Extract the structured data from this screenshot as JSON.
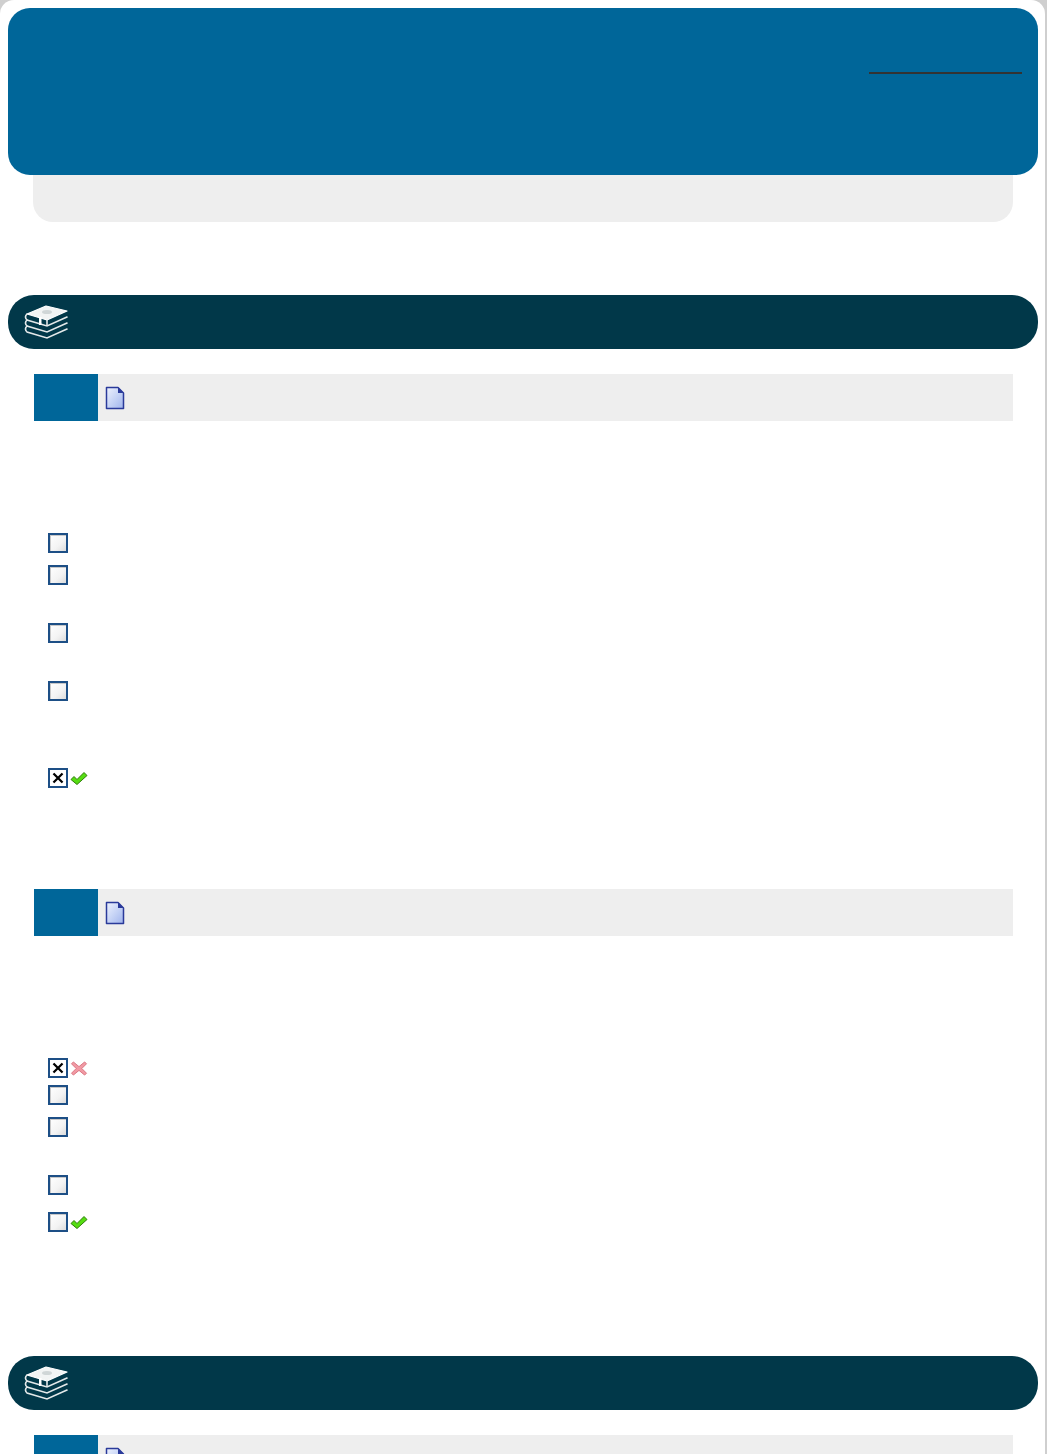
{
  "sections": [
    {
      "questions": [
        {
          "kind": "document",
          "options": [
            {
              "checked": false,
              "correct": false,
              "incorrect": false
            },
            {
              "checked": false,
              "correct": false,
              "incorrect": false
            },
            {
              "checked": false,
              "correct": false,
              "incorrect": false
            },
            {
              "checked": false,
              "correct": false,
              "incorrect": false
            },
            {
              "checked": true,
              "correct": true,
              "incorrect": false
            }
          ]
        },
        {
          "kind": "document",
          "options": [
            {
              "checked": true,
              "correct": false,
              "incorrect": true
            },
            {
              "checked": false,
              "correct": false,
              "incorrect": false
            },
            {
              "checked": false,
              "correct": false,
              "incorrect": false
            },
            {
              "checked": false,
              "correct": false,
              "incorrect": false
            },
            {
              "checked": false,
              "correct": true,
              "incorrect": false
            }
          ]
        }
      ]
    },
    {
      "questions": [
        {
          "kind": "document"
        }
      ]
    }
  ]
}
